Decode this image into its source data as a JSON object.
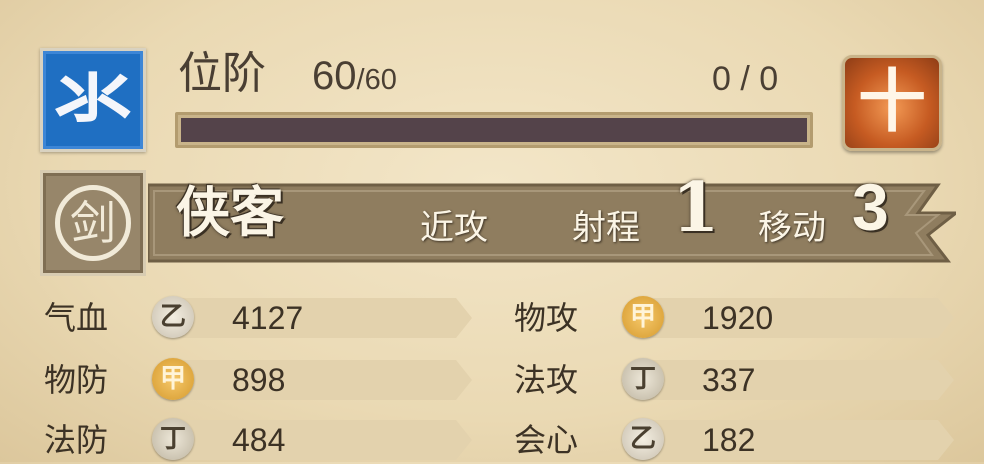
{
  "header": {
    "element_icon": {
      "glyph": "氺",
      "name": "water-element-icon",
      "color": "#1f6fc2"
    },
    "rank_label": "位阶",
    "rank_value": "60",
    "rank_separator": "/",
    "rank_max": "60",
    "exp_text": "0 / 0",
    "exp_progress": 0,
    "action_icon": {
      "glyph": "十",
      "name": "cross-skill-icon",
      "color": "#c65b22"
    }
  },
  "class_banner": {
    "emblem_glyph": "剑",
    "class_name": "侠客",
    "attack_type": "近攻",
    "range_label": "射程",
    "range_value": "1",
    "move_label": "移动",
    "move_value": "3"
  },
  "stats": [
    {
      "label": "气血",
      "grade": "乙",
      "grade_class": "yi",
      "value": "4127"
    },
    {
      "label": "物攻",
      "grade": "甲",
      "grade_class": "jia",
      "value": "1920"
    },
    {
      "label": "物防",
      "grade": "甲",
      "grade_class": "jia",
      "value": "898"
    },
    {
      "label": "法攻",
      "grade": "丁",
      "grade_class": "ding",
      "value": "337"
    },
    {
      "label": "法防",
      "grade": "丁",
      "grade_class": "ding",
      "value": "484"
    },
    {
      "label": "会心",
      "grade": "乙",
      "grade_class": "yi",
      "value": "182"
    }
  ],
  "colors": {
    "banner": "#8f7d5f",
    "banner_edge": "#6f5f45",
    "stat_bg": "#e3d2ad",
    "exp_bar": "#54434a"
  }
}
